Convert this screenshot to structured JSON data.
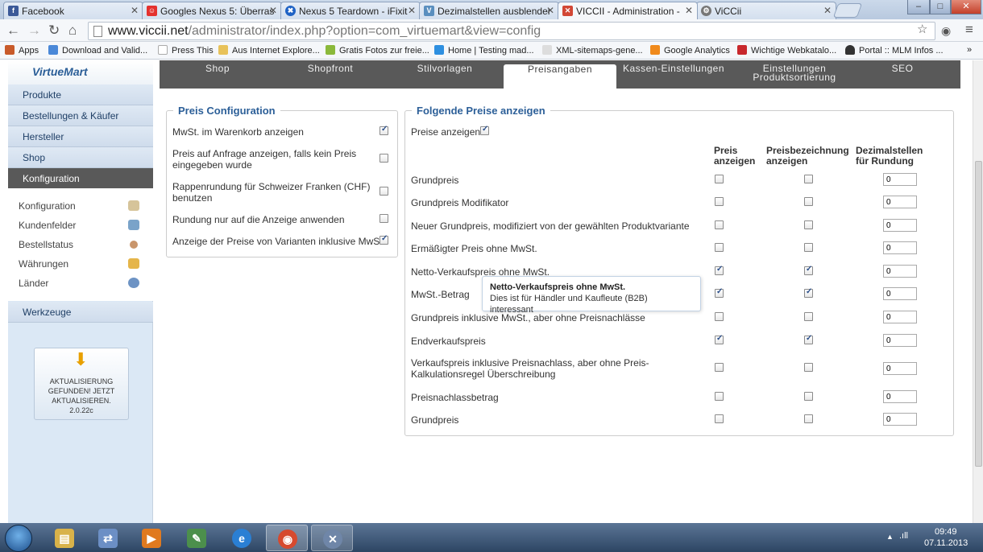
{
  "browser": {
    "tabs": [
      {
        "title": "Facebook",
        "color": "#3b5998",
        "glyph": "f"
      },
      {
        "title": "Googles Nexus 5: Überras",
        "color": "#e4312e",
        "glyph": "☺"
      },
      {
        "title": "Nexus 5 Teardown - iFixit",
        "color": "#1e62c5",
        "glyph": "✖"
      },
      {
        "title": "Dezimalstellen ausblender",
        "color": "#5a8fbf",
        "glyph": "V"
      },
      {
        "title": "VICCII - Administration - ",
        "color": "#d24735",
        "glyph": "✕"
      },
      {
        "title": "ViCCii",
        "color": "#777777",
        "glyph": "⚙"
      }
    ],
    "url_host": "www.viccii.net",
    "url_path": "/administrator/index.php?option=com_virtuemart&view=config",
    "bookmarks": [
      {
        "label": "Apps",
        "color": "#c85a2a"
      },
      {
        "label": "Download and Valid...",
        "color": "#4a88d8"
      },
      {
        "label": "Press This",
        "color": "#aaaaaa"
      },
      {
        "label": "Aus Internet Explore...",
        "color": "#e8c25a"
      },
      {
        "label": "Gratis Fotos zur freie...",
        "color": "#8bb93b"
      },
      {
        "label": "Home | Testing mad...",
        "color": "#2d8fe0"
      },
      {
        "label": "XML-sitemaps-gene...",
        "color": "#999999"
      },
      {
        "label": "Google Analytics",
        "color": "#f08a1c"
      },
      {
        "label": "Wichtige Webkatalo...",
        "color": "#c8282d"
      },
      {
        "label": "Portal :: MLM Infos ...",
        "color": "#333333"
      }
    ]
  },
  "sidebar": {
    "logo": "VirtueMart",
    "main_items": [
      {
        "label": "Produkte"
      },
      {
        "label": "Bestellungen & Käufer"
      },
      {
        "label": "Hersteller"
      },
      {
        "label": "Shop"
      },
      {
        "label": "Konfiguration"
      }
    ],
    "sub_items": [
      {
        "label": "Konfiguration",
        "color": "#d6c49a"
      },
      {
        "label": "Kundenfelder",
        "color": "#7aa3c9"
      },
      {
        "label": "Bestellstatus",
        "color": "#c9956b"
      },
      {
        "label": "Währungen",
        "color": "#e5b54a"
      },
      {
        "label": "Länder",
        "color": "#6d93c4"
      }
    ],
    "tools": "Werkzeuge",
    "update_text": "AKTUALISIERUNG GEFUNDEN! JETZT AKTUALISIEREN.",
    "update_version": "2.0.22c"
  },
  "tabs": [
    {
      "label": "Shop"
    },
    {
      "label": "Shopfront"
    },
    {
      "label": "Stilvorlagen"
    },
    {
      "label": "Preisangaben"
    },
    {
      "label": "Kassen-Einstellungen"
    },
    {
      "label": "Einstellungen",
      "label2": "Produktsortierung"
    },
    {
      "label": "SEO"
    }
  ],
  "left_panel": {
    "legend": "Preis Configuration",
    "rows": [
      {
        "label": "MwSt. im Warenkorb anzeigen",
        "checked": true
      },
      {
        "label": "Preis auf Anfrage anzeigen, falls kein Preis eingegeben wurde",
        "checked": false
      },
      {
        "label": "Rappenrundung für Schweizer Franken (CHF) benutzen",
        "checked": false
      },
      {
        "label": "Rundung nur auf die Anzeige anwenden",
        "checked": false
      },
      {
        "label": "Anzeige der Preise von Varianten inklusive MwSt",
        "checked": true
      }
    ]
  },
  "right_panel": {
    "legend": "Folgende Preise anzeigen",
    "show_prices_label": "Preise anzeigen",
    "show_prices_checked": true,
    "col_show": "Preis anzeigen",
    "col_label": "Preisbezeichnung anzeigen",
    "col_decimals": "Dezimalstellen für Rundung",
    "rows": [
      {
        "label": "Grundpreis",
        "show": false,
        "label_show": false,
        "decimals": "0"
      },
      {
        "label": "Grundpreis Modifikator",
        "show": false,
        "label_show": false,
        "decimals": "0"
      },
      {
        "label": "Neuer Grundpreis, modifiziert von der gewählten Produktvariante",
        "show": false,
        "label_show": false,
        "decimals": "0"
      },
      {
        "label": "Ermäßigter Preis ohne MwSt.",
        "show": false,
        "label_show": false,
        "decimals": "0"
      },
      {
        "label": "Netto-Verkaufspreis ohne MwSt.",
        "show": true,
        "label_show": true,
        "decimals": "0"
      },
      {
        "label": "MwSt.-Betrag",
        "show": true,
        "label_show": true,
        "decimals": "0"
      },
      {
        "label": "Grundpreis inklusive MwSt., aber ohne Preisnachlässe",
        "show": false,
        "label_show": false,
        "decimals": "0"
      },
      {
        "label": "Endverkaufspreis",
        "show": true,
        "label_show": true,
        "decimals": "0"
      },
      {
        "label": "Verkaufspreis inklusive Preisnachlass, aber ohne Preis-Kalkulationsregel Überschreibung",
        "show": false,
        "label_show": false,
        "decimals": "0"
      },
      {
        "label": "Preisnachlassbetrag",
        "show": false,
        "label_show": false,
        "decimals": "0"
      },
      {
        "label": "Grundpreis",
        "show": false,
        "label_show": false,
        "decimals": "0"
      }
    ]
  },
  "tooltip": {
    "title": "Netto-Verkaufspreis ohne MwSt.",
    "text": "Dies ist für Händler und Kaufleute (B2B) interessant"
  },
  "taskbar": {
    "time": "09:49",
    "date": "07.11.2013",
    "apps": [
      {
        "name": "explorer",
        "color": "#d8b24a"
      },
      {
        "name": "network",
        "color": "#6c8fc5"
      },
      {
        "name": "media",
        "color": "#e07a20"
      },
      {
        "name": "paint",
        "color": "#4c8f4c"
      },
      {
        "name": "ie",
        "color": "#2a7fd4"
      },
      {
        "name": "chrome",
        "color": "#d64a2f"
      },
      {
        "name": "tool",
        "color": "#6f86a8"
      }
    ]
  }
}
